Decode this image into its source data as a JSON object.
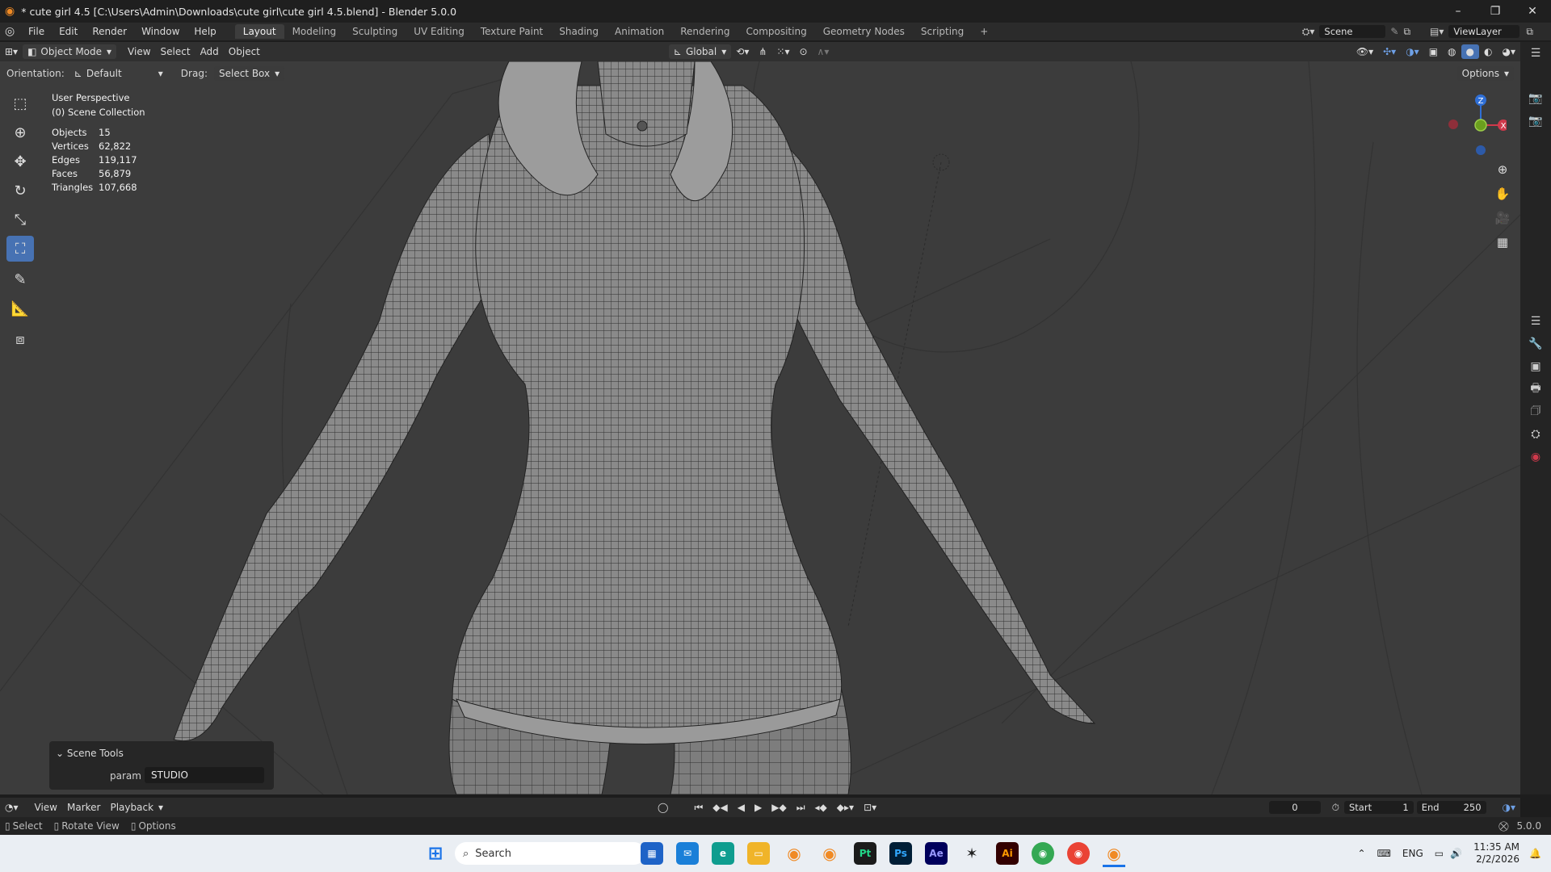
{
  "window": {
    "title": "* cute girl 4.5 [C:\\Users\\Admin\\Downloads\\cute girl\\cute girl 4.5.blend] - Blender 5.0.0",
    "buttons": [
      "–",
      "❐",
      "✕"
    ]
  },
  "menu": {
    "items": [
      "File",
      "Edit",
      "Render",
      "Window",
      "Help"
    ],
    "workspace_tabs": [
      "Layout",
      "Modeling",
      "Sculpting",
      "UV Editing",
      "Texture Paint",
      "Shading",
      "Animation",
      "Rendering",
      "Compositing",
      "Geometry Nodes",
      "Scripting"
    ],
    "active_tab": "Layout",
    "add_tab": "+",
    "scene": "Scene",
    "view_layer": "ViewLayer"
  },
  "header3d": {
    "mode": "Object Mode",
    "menus": [
      "View",
      "Select",
      "Add",
      "Object"
    ],
    "transform": "Global"
  },
  "tool_options": {
    "orientation_label": "Orientation:",
    "orientation_value": "Default",
    "drag_label": "Drag:",
    "drag_value": "Select Box",
    "options": "Options"
  },
  "overlay": {
    "view": "User Perspective",
    "collection": "(0) Scene Collection"
  },
  "stats": [
    {
      "label": "Objects",
      "value": "15"
    },
    {
      "label": "Vertices",
      "value": "62,822"
    },
    {
      "label": "Edges",
      "value": "119,117"
    },
    {
      "label": "Faces",
      "value": "56,879"
    },
    {
      "label": "Triangles",
      "value": "107,668"
    }
  ],
  "gizmo": {
    "z": "Z",
    "x": "X"
  },
  "scene_tools": {
    "header": "Scene Tools",
    "param_label": "param",
    "param_value": "STUDIO"
  },
  "timeline": {
    "menus": [
      "View",
      "Marker",
      "Playback"
    ],
    "current_frame": "0",
    "start_label": "Start",
    "start": "1",
    "end_label": "End",
    "end": "250"
  },
  "statusbar": {
    "items": [
      "Select",
      "Rotate View",
      "Options"
    ],
    "version": "5.0.0"
  },
  "taskbar": {
    "search": "Search",
    "lang": "ENG",
    "time": "11:35 AM",
    "date": "2/2/2026"
  },
  "colors": {
    "accent": "#4772b3",
    "viewport": "#3c3c3c",
    "axis_x": "#d0394b",
    "axis_y": "#6b9f1e",
    "axis_z": "#2f6fd6"
  }
}
